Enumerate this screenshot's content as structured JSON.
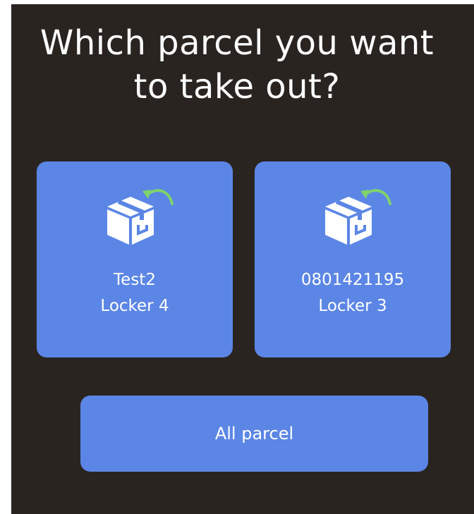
{
  "screen": {
    "title_line1": "Which parcel you want",
    "title_line2": "to take out?"
  },
  "parcels": [
    {
      "name": "Test2",
      "locker": "Locker 4",
      "icon": "package-return-icon"
    },
    {
      "name": "0801421195",
      "locker": "Locker 3",
      "icon": "package-return-icon"
    }
  ],
  "actions": {
    "all_label": "All parcel"
  },
  "colors": {
    "background": "#2a2421",
    "card": "#5b86e5",
    "arrow": "#7fd36b",
    "text": "#ffffff"
  }
}
